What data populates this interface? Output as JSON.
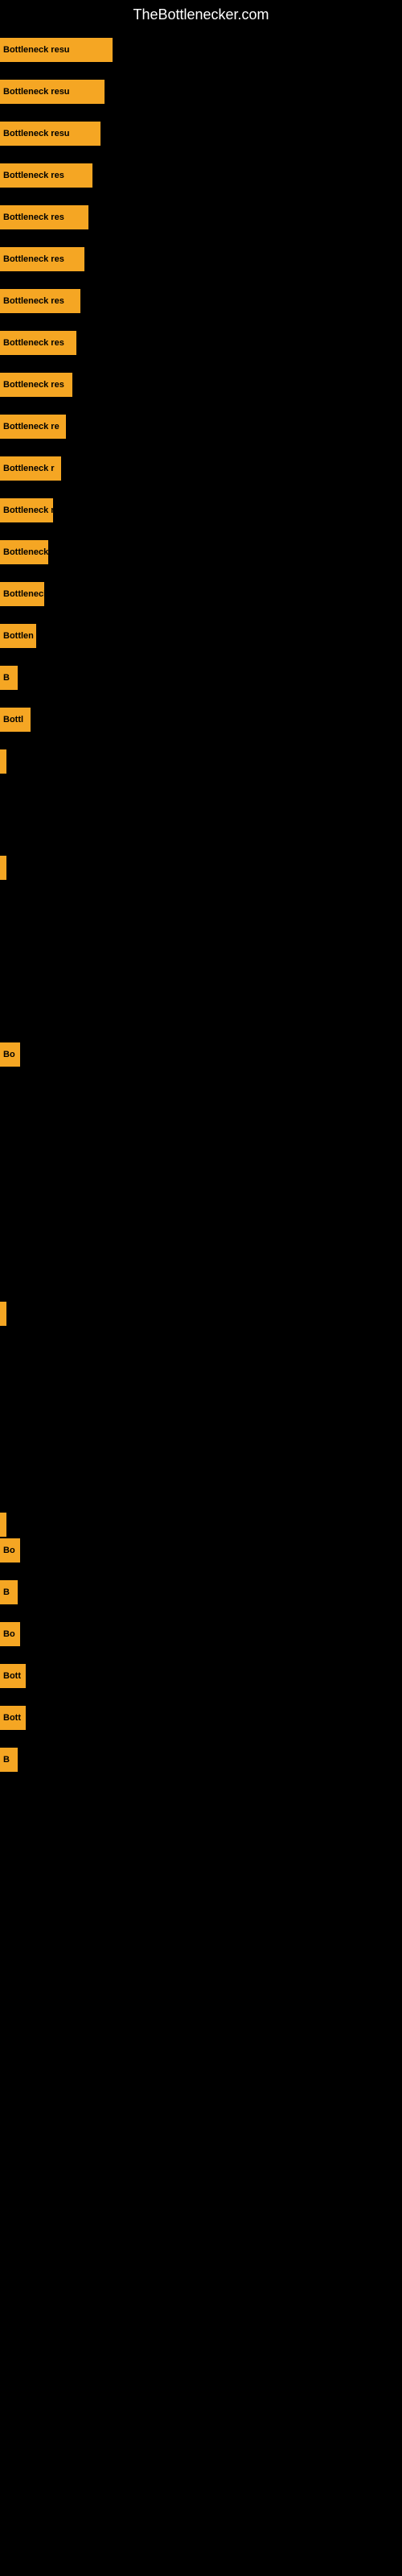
{
  "page": {
    "title": "TheBottlenecker.com"
  },
  "bars": [
    {
      "label": "Bottleneck resu",
      "width": 140
    },
    {
      "label": "Bottleneck resu",
      "width": 130
    },
    {
      "label": "Bottleneck resu",
      "width": 125
    },
    {
      "label": "Bottleneck res",
      "width": 115
    },
    {
      "label": "Bottleneck res",
      "width": 110
    },
    {
      "label": "Bottleneck res",
      "width": 105
    },
    {
      "label": "Bottleneck res",
      "width": 100
    },
    {
      "label": "Bottleneck res",
      "width": 95
    },
    {
      "label": "Bottleneck res",
      "width": 90
    },
    {
      "label": "Bottleneck re",
      "width": 80
    },
    {
      "label": "Bottleneck re",
      "width": 75
    },
    {
      "label": "Bottleneck r",
      "width": 65
    },
    {
      "label": "Bottleneck r",
      "width": 60
    },
    {
      "label": "Bottleneck r",
      "width": 55
    },
    {
      "label": "Bottlen",
      "width": 45
    },
    {
      "label": "B",
      "width": 22
    },
    {
      "label": "Bottl",
      "width": 38
    },
    {
      "label": "|",
      "width": 8
    },
    {
      "label": "",
      "width": 0
    },
    {
      "label": "|",
      "width": 8
    },
    {
      "label": "",
      "width": 0
    },
    {
      "label": "",
      "width": 0
    },
    {
      "label": "Bo",
      "width": 25
    },
    {
      "label": "",
      "width": 0
    },
    {
      "label": "",
      "width": 0
    },
    {
      "label": "",
      "width": 0
    },
    {
      "label": "",
      "width": 0
    },
    {
      "label": "|",
      "width": 8
    },
    {
      "label": "",
      "width": 0
    },
    {
      "label": "",
      "width": 0
    },
    {
      "label": "|",
      "width": 8
    },
    {
      "label": "Bo",
      "width": 25
    },
    {
      "label": "B",
      "width": 22
    },
    {
      "label": "Bo",
      "width": 25
    },
    {
      "label": "Bott",
      "width": 32
    },
    {
      "label": "Bott",
      "width": 32
    },
    {
      "label": "B",
      "width": 22
    }
  ],
  "spacers": []
}
